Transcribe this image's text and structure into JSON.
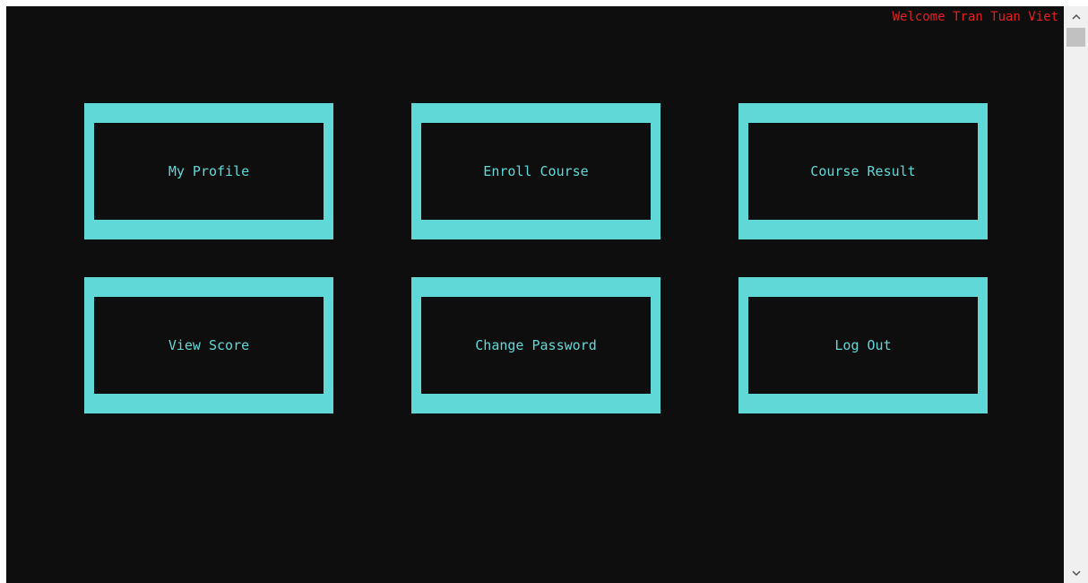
{
  "header": {
    "welcome_text": "Welcome Tran Tuan Viet"
  },
  "menu": {
    "tiles": [
      {
        "label": "My Profile"
      },
      {
        "label": "Enroll Course"
      },
      {
        "label": "Course Result"
      },
      {
        "label": "View Score"
      },
      {
        "label": "Change Password"
      },
      {
        "label": "Log Out"
      }
    ]
  },
  "scrollbar": {
    "up_icon": "chevron-up-icon",
    "down_icon": "chevron-down-icon"
  },
  "colors": {
    "background": "#0e0e0e",
    "accent": "#61d8d8",
    "welcome_text": "#e02020"
  }
}
